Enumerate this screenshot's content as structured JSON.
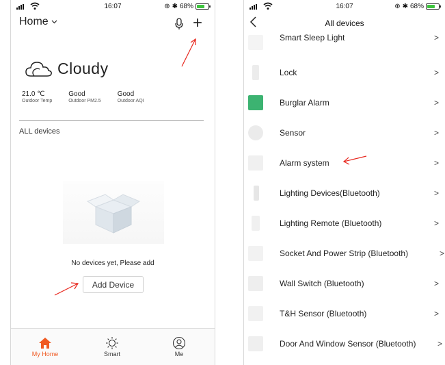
{
  "left_screen": {
    "status": {
      "time": "16:07",
      "battery": "68%"
    },
    "header": {
      "title": "Home"
    },
    "weather": {
      "condition": "Cloudy"
    },
    "stats": [
      {
        "value": "21.0 ℃",
        "label": "Outdoor Temp"
      },
      {
        "value": "Good",
        "label": "Outdoor PM2.5"
      },
      {
        "value": "Good",
        "label": "Outdoor AQI"
      }
    ],
    "section_label": "ALL devices",
    "empty_message": "No devices yet, Please add",
    "add_button_label": "Add Device",
    "tabs": [
      {
        "label": "My Home",
        "icon": "home-icon",
        "active": true
      },
      {
        "label": "Smart",
        "icon": "sun-icon",
        "active": false
      },
      {
        "label": "Me",
        "icon": "user-icon",
        "active": false
      }
    ]
  },
  "right_screen": {
    "status": {
      "time": "16:07",
      "battery": "68%"
    },
    "nav": {
      "title": "All devices"
    },
    "devices": [
      {
        "label": "Smart Sleep Light"
      },
      {
        "label": "Lock"
      },
      {
        "label": "Burglar Alarm"
      },
      {
        "label": "Sensor"
      },
      {
        "label": "Alarm system"
      },
      {
        "label": "Lighting Devices(Bluetooth)"
      },
      {
        "label": "Lighting Remote (Bluetooth)"
      },
      {
        "label": "Socket And Power Strip (Bluetooth)"
      },
      {
        "label": "Wall Switch (Bluetooth)"
      },
      {
        "label": "T&H Sensor (Bluetooth)"
      },
      {
        "label": "Door And Window Sensor (Bluetooth)"
      }
    ],
    "chevron": ">"
  },
  "colors": {
    "accent": "#f05a22",
    "annotation": "#e8261d",
    "battery": "#3ec43e",
    "burglar_thumb": "#3cb371"
  }
}
